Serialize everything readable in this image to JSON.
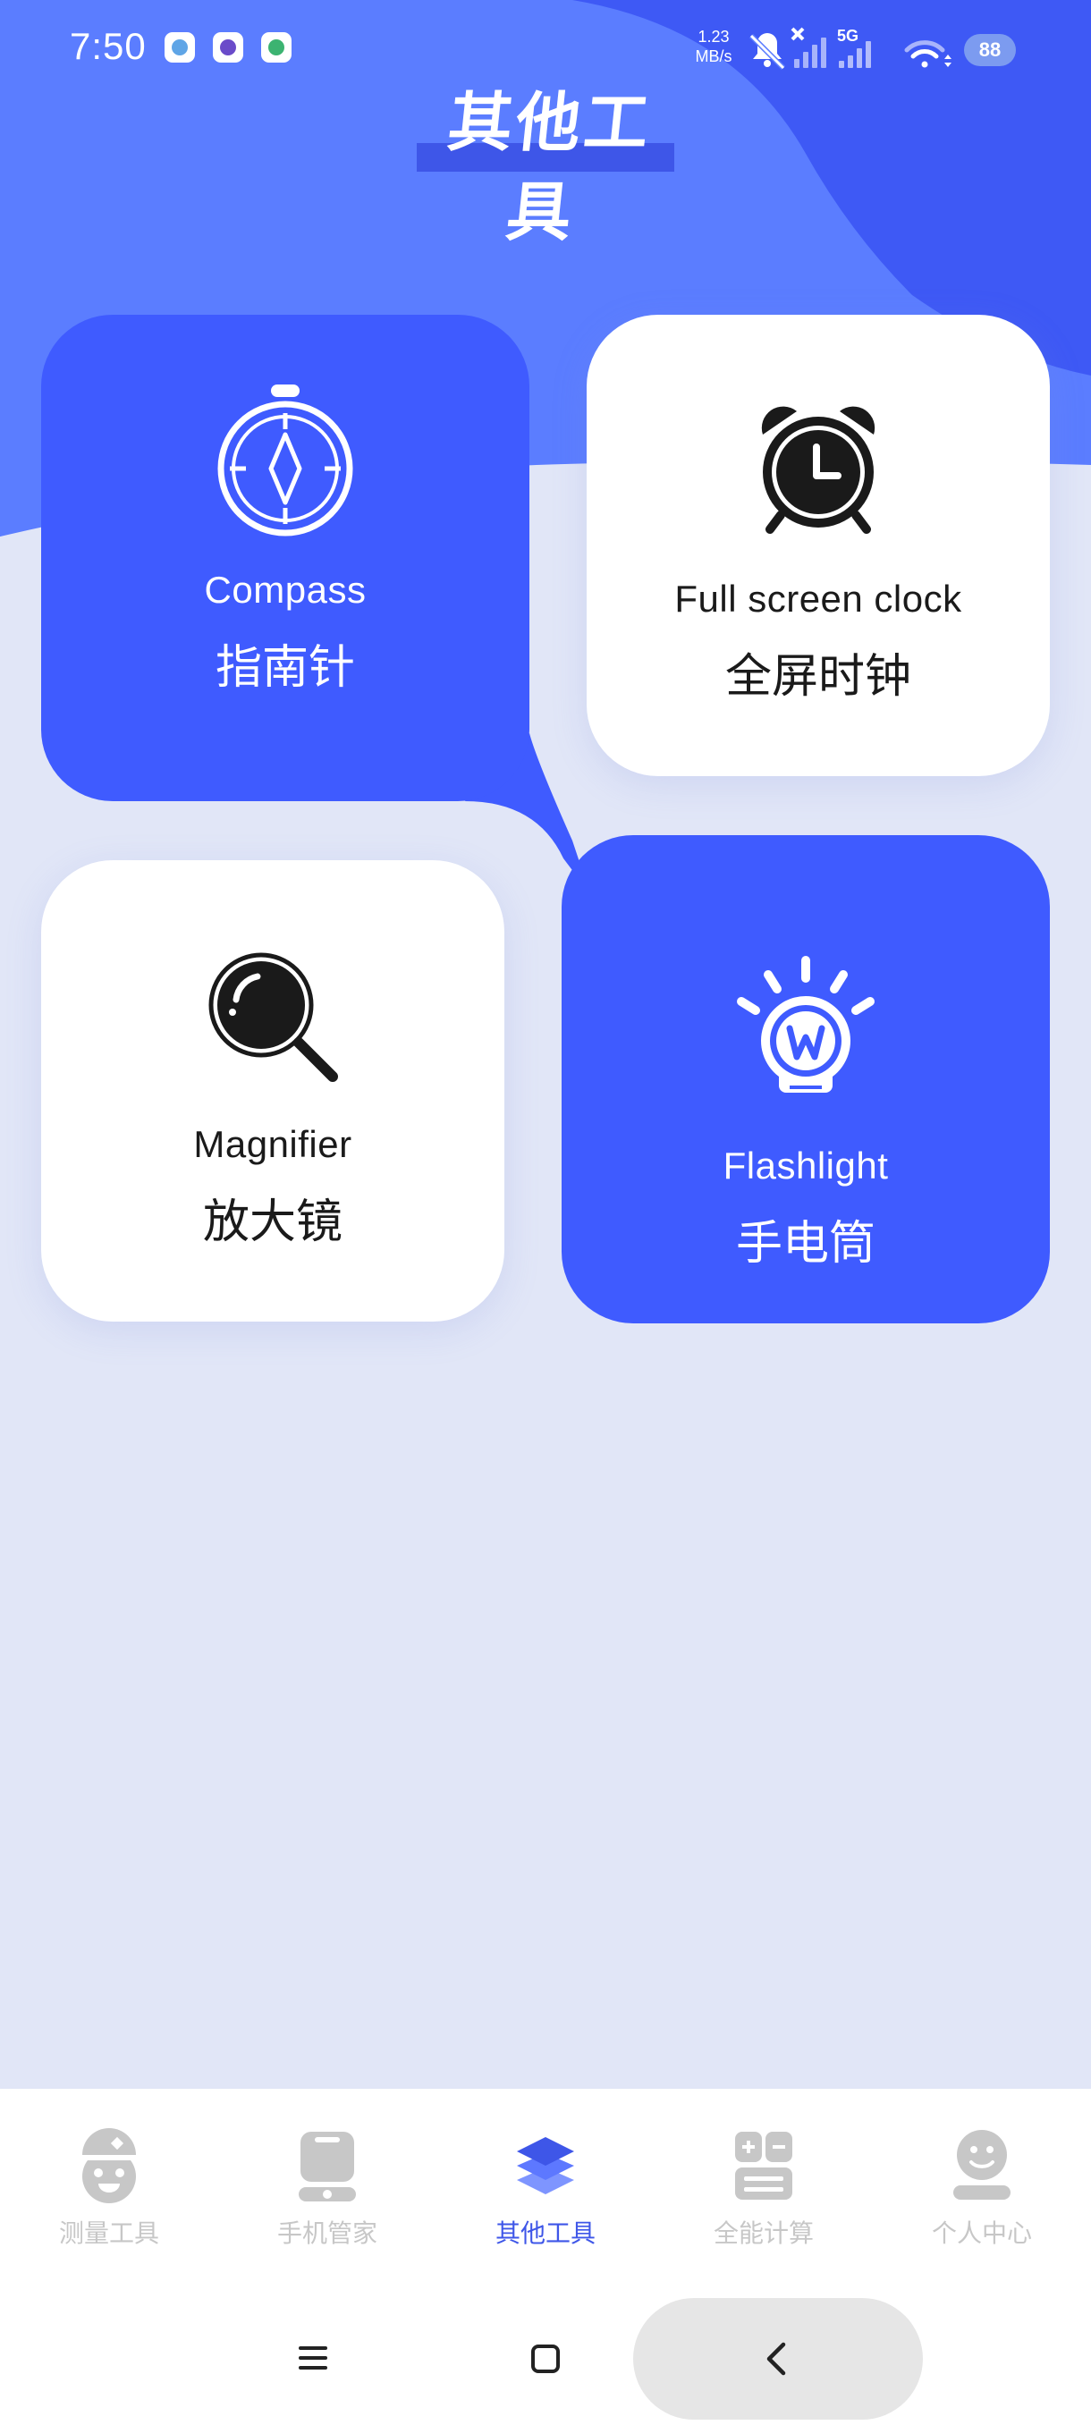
{
  "status_bar": {
    "time": "7:50",
    "net_speed_value": "1.23",
    "net_speed_unit": "MB/s",
    "network_type": "5G",
    "battery_level": "88"
  },
  "header": {
    "title": "其他工具"
  },
  "tools": [
    {
      "label_en": "Compass",
      "label_zh": "指南针",
      "icon": "compass-icon"
    },
    {
      "label_en": "Full screen clock",
      "label_zh": "全屏时钟",
      "icon": "alarm-clock-icon"
    },
    {
      "label_en": "Magnifier",
      "label_zh": "放大镜",
      "icon": "magnifier-icon"
    },
    {
      "label_en": "Flashlight",
      "label_zh": "手电筒",
      "icon": "lightbulb-icon"
    }
  ],
  "bottom_nav": {
    "items": [
      {
        "label": "测量工具",
        "icon": "measure-tools-icon",
        "active": false
      },
      {
        "label": "手机管家",
        "icon": "phone-manager-icon",
        "active": false
      },
      {
        "label": "其他工具",
        "icon": "layers-icon",
        "active": true
      },
      {
        "label": "全能计算",
        "icon": "calculator-icon",
        "active": false
      },
      {
        "label": "个人中心",
        "icon": "profile-icon",
        "active": false
      }
    ]
  },
  "colors": {
    "primary_blue": "#3F5BFF",
    "header_blue": "#5B7DFF",
    "background": "#E1E6F7",
    "nav_active": "#3E56E8",
    "nav_inactive": "#C7C7C7"
  }
}
